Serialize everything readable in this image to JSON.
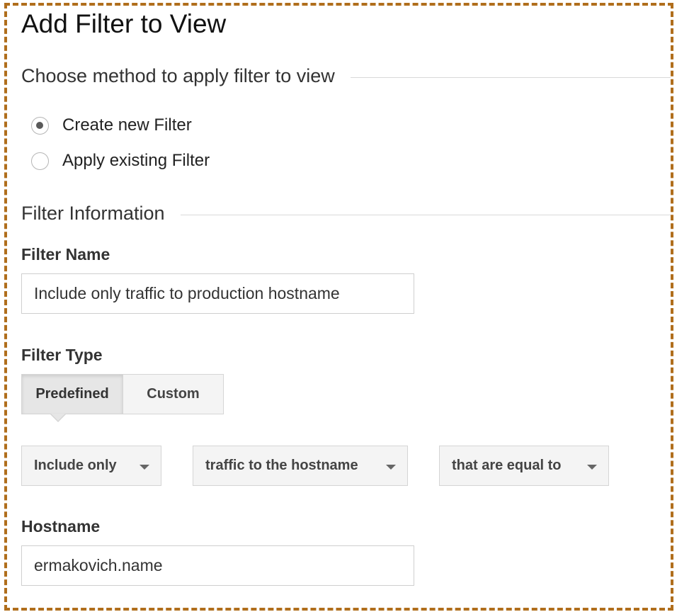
{
  "page": {
    "title": "Add Filter to View"
  },
  "method_section": {
    "title": "Choose method to apply filter to view",
    "options": [
      {
        "label": "Create new Filter",
        "checked": true
      },
      {
        "label": "Apply existing Filter",
        "checked": false
      }
    ]
  },
  "filter_info": {
    "title": "Filter Information",
    "name_label": "Filter Name",
    "name_value": "Include only traffic to production hostname",
    "type_label": "Filter Type",
    "type_tabs": [
      {
        "label": "Predefined",
        "active": true
      },
      {
        "label": "Custom",
        "active": false
      }
    ],
    "dropdowns": [
      {
        "label": "Include only"
      },
      {
        "label": "traffic to the hostname"
      },
      {
        "label": "that are equal to"
      }
    ],
    "hostname_label": "Hostname",
    "hostname_value": "ermakovich.name"
  },
  "colors": {
    "frame_border": "#b06e1c",
    "active_tab_bg": "#e6e6e6",
    "inactive_bg": "#f4f4f4"
  },
  "icons": {
    "dropdown": "chevron-down-icon"
  }
}
